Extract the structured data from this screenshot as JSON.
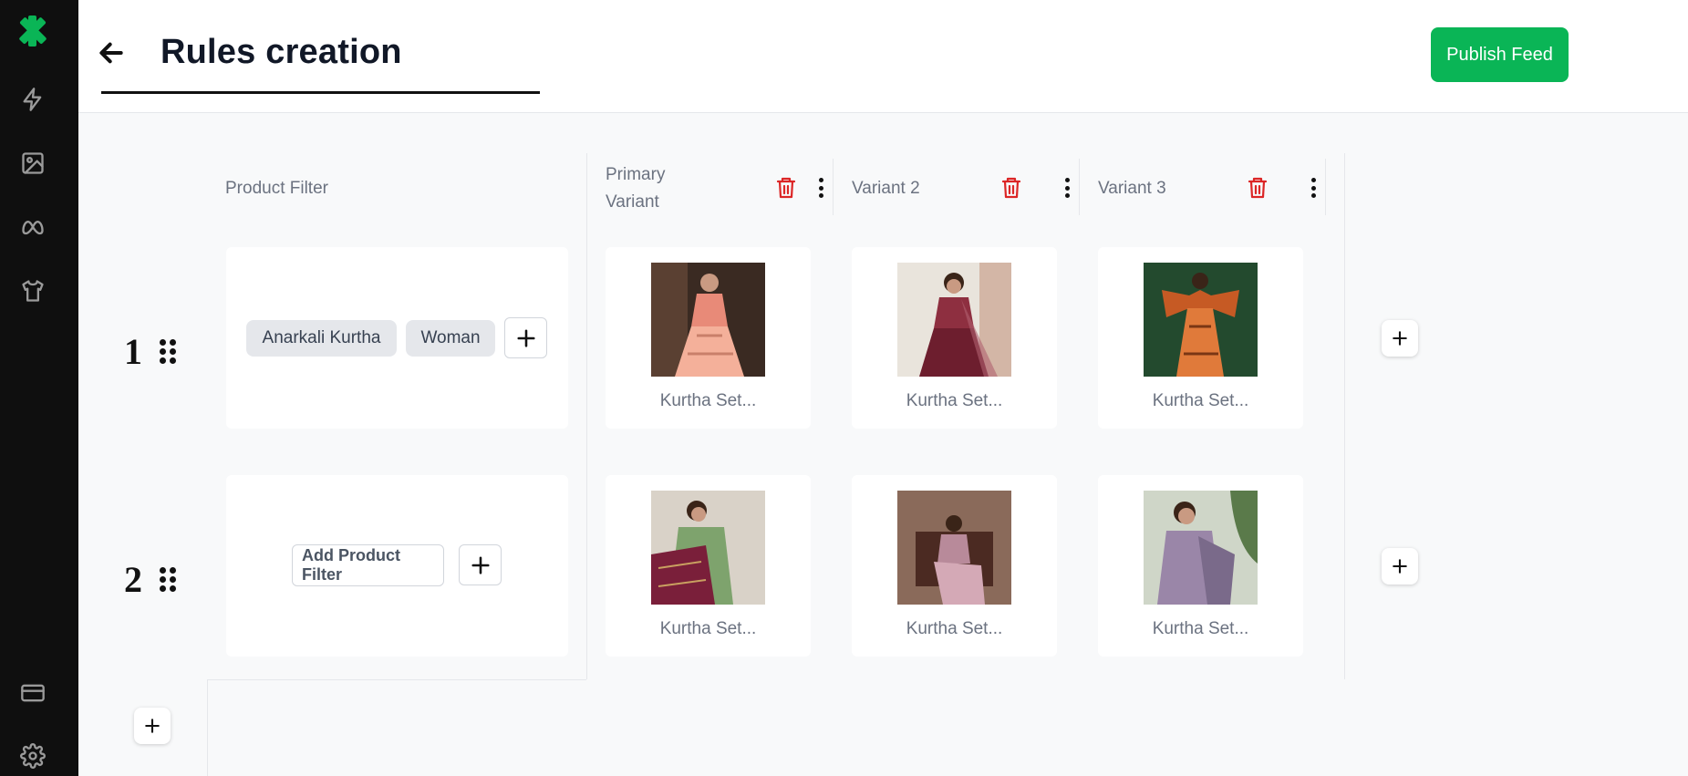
{
  "sidebar": {
    "icons": [
      "logo-icon",
      "bolt-icon",
      "image-icon",
      "meta-icon",
      "tshirt-icon",
      "card-icon",
      "gear-icon"
    ]
  },
  "header": {
    "title": "Rules creation",
    "publish_label": "Publish Feed"
  },
  "columns": {
    "filter_header": "Product Filter",
    "variants": [
      {
        "line1": "Primary",
        "line2": "Variant"
      },
      {
        "line1": "Variant 2",
        "line2": ""
      },
      {
        "line1": "Variant 3",
        "line2": ""
      }
    ]
  },
  "rows": [
    {
      "number": "1",
      "chips": [
        "Anarkali Kurtha",
        "Woman"
      ],
      "variants": [
        {
          "label": "Kurtha Set...",
          "palette": [
            "#3a2a22",
            "#e88a78",
            "#f4b09a",
            "#c97f6a"
          ]
        },
        {
          "label": "Kurtha Set...",
          "palette": [
            "#e9e4dc",
            "#8e2f40",
            "#6d1e2e",
            "#d3b6a6"
          ]
        },
        {
          "label": "Kurtha Set...",
          "palette": [
            "#234a2e",
            "#c65a24",
            "#e07a3a",
            "#7a3614"
          ]
        }
      ]
    },
    {
      "number": "2",
      "add_filter_label": "Add Product Filter",
      "variants": [
        {
          "label": "Kurtha Set...",
          "palette": [
            "#d9d2c8",
            "#7ea36d",
            "#7a1f3a",
            "#5a9a5a"
          ]
        },
        {
          "label": "Kurtha Set...",
          "palette": [
            "#8a6a5a",
            "#b88a9a",
            "#d4a9b6",
            "#4b2a22"
          ]
        },
        {
          "label": "Kurtha Set...",
          "palette": [
            "#cfd6c8",
            "#9a86a8",
            "#7a6a8a",
            "#5a7a4a"
          ]
        }
      ]
    }
  ],
  "colors": {
    "accent": "#0ab556",
    "danger": "#dc2626",
    "sidebar_bg": "#0f0f0f"
  }
}
